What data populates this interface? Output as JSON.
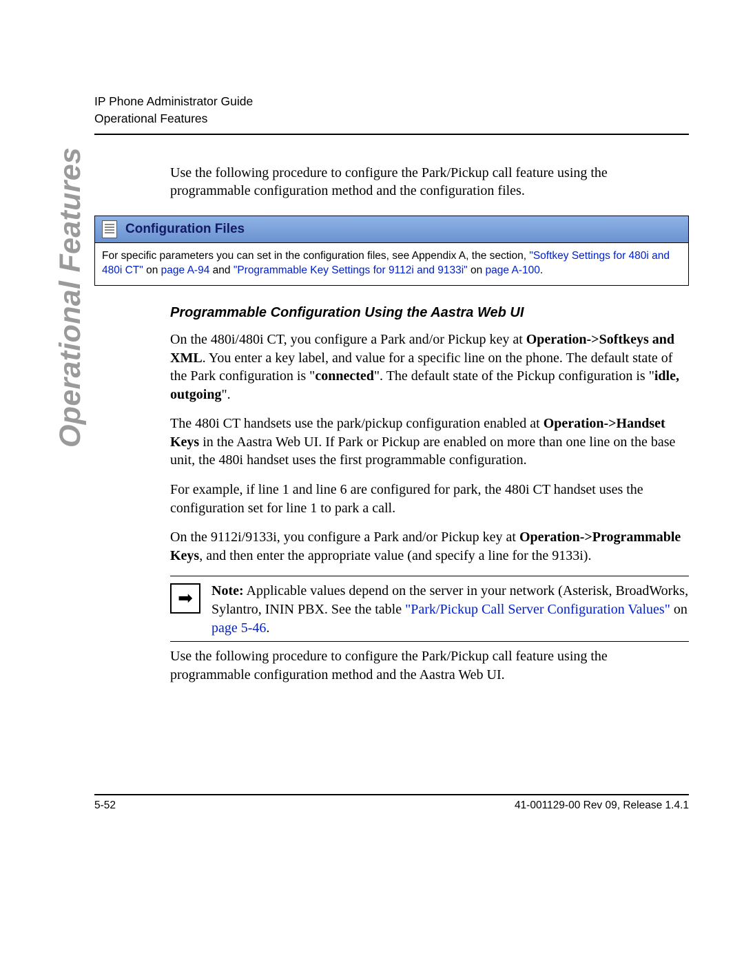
{
  "header": {
    "line1": "IP Phone Administrator Guide",
    "line2": "Operational Features"
  },
  "sideTab": "Operational Features",
  "intro": "Use the following procedure to configure the Park/Pickup call feature using the programmable configuration method and the configuration files.",
  "configBox": {
    "title": "Configuration Files",
    "body_pre": "For specific parameters you can set in the configuration files, see Appendix A, the section, ",
    "link1": "\"Softkey Settings for 480i and 480i CT\"",
    "on1": " on ",
    "page1": "page A-94",
    "and": " and ",
    "link2": "\"Programmable Key Settings for 9112i and 9133i\"",
    "on2": " on ",
    "page2": "page A-100",
    "tail": "."
  },
  "subheading": "Programmable Configuration Using the Aastra Web UI",
  "p1": {
    "a": "On the 480i/480i CT, you configure a Park and/or Pickup key at ",
    "b": "Operation->Softkeys and XML",
    "c": ". You enter a key label, and value for a specific line on the phone. The default state of the Park configuration is \"",
    "d": "connected",
    "e": "\". The default state of the Pickup configuration is \"",
    "f": "idle, outgoing",
    "g": "\"."
  },
  "p2": {
    "a": "The 480i CT handsets use the park/pickup configuration enabled at ",
    "b": "Operation->Handset Keys",
    "c": " in the Aastra Web UI. If Park or Pickup are enabled on more than one line on the base unit, the 480i handset uses the first programmable configuration."
  },
  "p3": "For example, if line 1 and line 6 are configured for park, the 480i CT handset uses the configuration set for line 1 to park a call.",
  "p4": {
    "a": "On the 9112i/9133i, you configure a Park and/or Pickup key at ",
    "b": "Operation->Programmable Keys",
    "c": ", and then enter the appropriate value (and specify a line for the 9133i)."
  },
  "note": {
    "label": "Note:",
    "a": " Applicable values depend on the server in your network (Asterisk, BroadWorks, Sylantro, ININ PBX. See the table ",
    "link": "\"Park/Pickup Call Server Configuration Values\"",
    "on": " on ",
    "page": "page 5-46",
    "tail": "."
  },
  "p5": "Use the following procedure to configure the Park/Pickup call feature using the programmable configuration method and the Aastra Web UI.",
  "footer": {
    "left": "5-52",
    "right": "41-001129-00 Rev 09, Release 1.4.1"
  }
}
